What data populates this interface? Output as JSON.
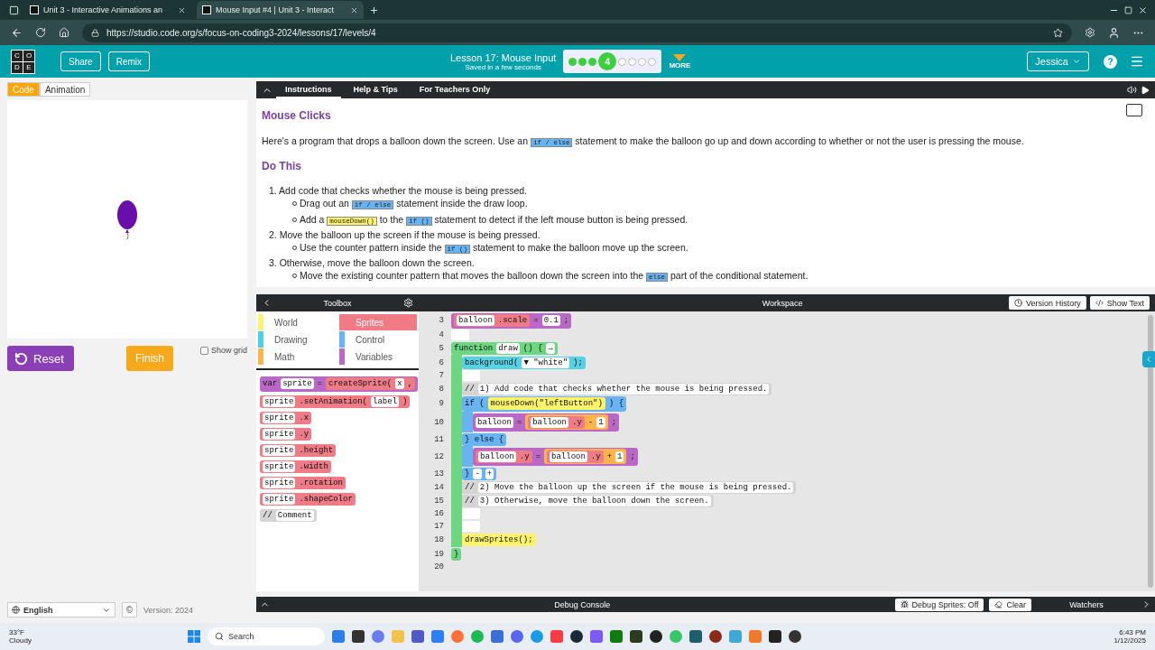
{
  "browser": {
    "tabs": [
      {
        "title": "Unit 3 - Interactive Animations an",
        "selected": false
      },
      {
        "title": "Mouse Input #4 | Unit 3 - Interact",
        "selected": true
      }
    ],
    "url": "https://studio.code.org/s/focus-on-coding3-2024/lessons/17/levels/4"
  },
  "header": {
    "logo": [
      "C",
      "O",
      "D",
      "E"
    ],
    "buttons": [
      "Share",
      "Remix"
    ],
    "lesson": "Lesson 17: Mouse Input",
    "saved": "Saved in a few seconds",
    "progress": [
      {
        "kind": "done"
      },
      {
        "kind": "done"
      },
      {
        "kind": "done"
      },
      {
        "kind": "current",
        "label": "4"
      },
      {
        "kind": "todo"
      },
      {
        "kind": "todo"
      },
      {
        "kind": "todo"
      },
      {
        "kind": "todo"
      }
    ],
    "more": "MORE",
    "user": "Jessica",
    "help": "?"
  },
  "left": {
    "tabs": [
      {
        "label": "Code",
        "selected": true
      },
      {
        "label": "Animation",
        "selected": false
      }
    ],
    "reset": "Reset",
    "finish": "Finish",
    "show_grid": {
      "label": "Show grid",
      "checked": false
    },
    "language": "English",
    "copyright": "©",
    "version": "Version: 2024"
  },
  "instructions": {
    "tabs": [
      {
        "label": "Instructions",
        "selected": true
      },
      {
        "label": "Help & Tips",
        "selected": false
      },
      {
        "label": "For Teachers Only",
        "selected": false
      }
    ],
    "title": "Mouse Clicks",
    "intro": [
      {
        "kind": "text",
        "text": "Here's a program that drops a balloon down the screen. Use an "
      },
      {
        "kind": "control",
        "text": "if / else"
      },
      {
        "kind": "text",
        "text": " statement to make the balloon go up and down according to whether or not the user is pressing the mouse."
      }
    ],
    "heading": "Do This",
    "steps": [
      {
        "number": "1.",
        "parts": [
          {
            "kind": "text",
            "text": "Add code that checks whether the mouse is being pressed."
          }
        ],
        "children": [
          {
            "parts": [
              {
                "kind": "text",
                "text": "Drag out an "
              },
              {
                "kind": "control",
                "text": "if / else"
              },
              {
                "kind": "text",
                "text": " statement inside the draw loop."
              }
            ]
          },
          {
            "parts": [
              {
                "kind": "text",
                "text": "Add a "
              },
              {
                "kind": "world",
                "text": "mouseDown()"
              },
              {
                "kind": "text",
                "text": " to the "
              },
              {
                "kind": "control",
                "text": "if ()"
              },
              {
                "kind": "text",
                "text": " statement to detect if the left mouse button is being pressed."
              }
            ]
          }
        ]
      },
      {
        "number": "2.",
        "parts": [
          {
            "kind": "text",
            "text": "Move the balloon up the screen if the mouse is being pressed."
          }
        ],
        "children": [
          {
            "parts": [
              {
                "kind": "text",
                "text": "Use the counter pattern inside the "
              },
              {
                "kind": "control",
                "text": "if ()"
              },
              {
                "kind": "text",
                "text": " statement to make the balloon move up the screen."
              }
            ]
          }
        ]
      },
      {
        "number": "3.",
        "parts": [
          {
            "kind": "text",
            "text": "Otherwise, move the balloon down the screen."
          }
        ],
        "children": [
          {
            "parts": [
              {
                "kind": "text",
                "text": "Move the existing counter pattern that moves the balloon down the screen into the "
              },
              {
                "kind": "control",
                "text": "else"
              },
              {
                "kind": "text",
                "text": " part of the conditional statement."
              }
            ]
          }
        ]
      }
    ]
  },
  "toolbox": {
    "title": "Toolbox",
    "categories": [
      {
        "label": "World",
        "color": "#fff176",
        "selected": false
      },
      {
        "label": "Sprites",
        "color": "#f07b85",
        "selected": true
      },
      {
        "label": "Drawing",
        "color": "#4dd0e1",
        "selected": false
      },
      {
        "label": "Control",
        "color": "#64b5f6",
        "selected": false
      },
      {
        "label": "Math",
        "color": "#ffb74d",
        "selected": false
      },
      {
        "label": "Variables",
        "color": "#ba68c8",
        "selected": false
      }
    ],
    "blocks": [
      {
        "kind": "variables",
        "parts": [
          {
            "kind": "text",
            "text": "var"
          },
          {
            "kind": "slot",
            "text": "sprite"
          },
          {
            "kind": "text",
            "text": "="
          },
          {
            "kind": "sprites",
            "parts": [
              {
                "kind": "text",
                "text": "createSprite("
              },
              {
                "kind": "slot",
                "text": "x"
              },
              {
                "kind": "text",
                "text": ","
              }
            ]
          }
        ]
      },
      {
        "kind": "sprites",
        "parts": [
          {
            "kind": "slot",
            "text": "sprite"
          },
          {
            "kind": "text",
            "text": ".setAnimation("
          },
          {
            "kind": "slot",
            "text": "label"
          },
          {
            "kind": "text",
            "text": ")"
          }
        ]
      },
      {
        "kind": "sprites",
        "parts": [
          {
            "kind": "slot",
            "text": "sprite"
          },
          {
            "kind": "text",
            "text": ".x"
          }
        ]
      },
      {
        "kind": "sprites",
        "parts": [
          {
            "kind": "slot",
            "text": "sprite"
          },
          {
            "kind": "text",
            "text": ".y"
          }
        ]
      },
      {
        "kind": "sprites",
        "parts": [
          {
            "kind": "slot",
            "text": "sprite"
          },
          {
            "kind": "text",
            "text": ".height"
          }
        ]
      },
      {
        "kind": "sprites",
        "parts": [
          {
            "kind": "slot",
            "text": "sprite"
          },
          {
            "kind": "text",
            "text": ".width"
          }
        ]
      },
      {
        "kind": "sprites",
        "parts": [
          {
            "kind": "slot",
            "text": "sprite"
          },
          {
            "kind": "text",
            "text": ".rotation"
          }
        ]
      },
      {
        "kind": "sprites",
        "parts": [
          {
            "kind": "slot",
            "text": "sprite"
          },
          {
            "kind": "text",
            "text": ".shapeColor"
          }
        ]
      },
      {
        "kind": "comment",
        "parts": [
          {
            "kind": "text",
            "text": "//"
          },
          {
            "kind": "slot",
            "text": "Comment"
          }
        ]
      }
    ]
  },
  "workspace": {
    "title": "Workspace",
    "buttons": [
      "Version History",
      "Show Text"
    ],
    "blocks": [
      {
        "kind": "variables",
        "line": "3",
        "parts": [
          {
            "kind": "sprites",
            "parts": [
              {
                "kind": "slot",
                "text": "balloon"
              },
              {
                "kind": "text",
                "text": ".scale"
              }
            ]
          },
          {
            "kind": "text",
            "text": "="
          },
          {
            "kind": "slot",
            "text": "0.1"
          },
          {
            "kind": "text",
            "text": ";"
          }
        ]
      },
      {
        "kind": "empty",
        "line": "4"
      },
      {
        "kind": "function",
        "line": "5",
        "parts": [
          {
            "kind": "text",
            "text": "function"
          },
          {
            "kind": "slot",
            "text": "draw"
          },
          {
            "kind": "text",
            "text": "() {"
          },
          {
            "kind": "slot",
            "text": "→"
          }
        ],
        "children": [
          {
            "kind": "drawing",
            "line": "6",
            "parts": [
              {
                "kind": "text",
                "text": "background("
              },
              {
                "kind": "slot",
                "text": "▼ \"white\""
              },
              {
                "kind": "text",
                "text": ");"
              }
            ]
          },
          {
            "kind": "empty",
            "line": "7"
          },
          {
            "kind": "comment",
            "line": "8",
            "parts": [
              {
                "kind": "text",
                "text": "//"
              },
              {
                "kind": "slot",
                "text": "1) Add code that checks whether the mouse is being pressed."
              }
            ]
          },
          {
            "kind": "control",
            "line": "9",
            "parts": [
              {
                "kind": "text",
                "text": "if ("
              },
              {
                "kind": "world",
                "parts": [
                  {
                    "kind": "text",
                    "text": "mouseDown(\"leftButton\")"
                  }
                ]
              },
              {
                "kind": "text",
                "text": ") {"
              }
            ],
            "children": [
              {
                "kind": "variables",
                "line": "10",
                "parts": [
                  {
                    "kind": "slot",
                    "text": "balloon"
                  },
                  {
                    "kind": "text",
                    "text": "="
                  },
                  {
                    "kind": "math",
                    "parts": [
                      {
                        "kind": "sprites",
                        "parts": [
                          {
                            "kind": "slot",
                            "text": "balloon"
                          },
                          {
                            "kind": "text",
                            "text": ".y"
                          }
                        ]
                      },
                      {
                        "kind": "text",
                        "text": "-"
                      },
                      {
                        "kind": "slot",
                        "text": "1"
                      }
                    ]
                  },
                  {
                    "kind": "text",
                    "text": ";"
                  }
                ]
              }
            ],
            "else_line": "11",
            "else_parts": [
              {
                "kind": "text",
                "text": "} else {"
              }
            ],
            "else_children": [
              {
                "kind": "variables",
                "line": "12",
                "parts": [
                  {
                    "kind": "sprites",
                    "parts": [
                      {
                        "kind": "slot",
                        "text": "balloon"
                      },
                      {
                        "kind": "text",
                        "text": ".y"
                      }
                    ]
                  },
                  {
                    "kind": "text",
                    "text": "="
                  },
                  {
                    "kind": "math",
                    "parts": [
                      {
                        "kind": "sprites",
                        "parts": [
                          {
                            "kind": "slot",
                            "text": "balloon"
                          },
                          {
                            "kind": "text",
                            "text": ".y"
                          }
                        ]
                      },
                      {
                        "kind": "text",
                        "text": "+"
                      },
                      {
                        "kind": "slot",
                        "text": "1"
                      }
                    ]
                  },
                  {
                    "kind": "text",
                    "text": ";"
                  }
                ]
              }
            ],
            "end_line": "13",
            "end_parts": [
              {
                "kind": "text",
                "text": "}"
              },
              {
                "kind": "slot",
                "text": "-"
              },
              {
                "kind": "slot",
                "text": "+"
              }
            ]
          },
          {
            "kind": "comment",
            "line": "14",
            "parts": [
              {
                "kind": "text",
                "text": "//"
              },
              {
                "kind": "slot",
                "text": "2) Move the balloon up the screen if the mouse is being pressed."
              }
            ]
          },
          {
            "kind": "comment",
            "line": "15",
            "parts": [
              {
                "kind": "text",
                "text": "//"
              },
              {
                "kind": "slot",
                "text": "3) Otherwise, move the balloon down the screen."
              }
            ]
          },
          {
            "kind": "empty",
            "line": "16"
          },
          {
            "kind": "empty",
            "line": "17"
          },
          {
            "kind": "world",
            "line": "18",
            "parts": [
              {
                "kind": "text",
                "text": "drawSprites();"
              }
            ]
          }
        ],
        "end_line": "19",
        "end_parts": [
          {
            "kind": "text",
            "text": "}"
          }
        ]
      }
    ],
    "trailing_lines": [
      "20"
    ]
  },
  "debug": {
    "title": "Debug Console",
    "buttons": [
      "Debug Sprites: Off",
      "Clear"
    ],
    "watchers": "Watchers"
  },
  "taskbar": {
    "temperature": "33°F",
    "weather": "Cloudy",
    "search": "Search",
    "time": "6:43 PM",
    "date": "1/12/2025"
  }
}
